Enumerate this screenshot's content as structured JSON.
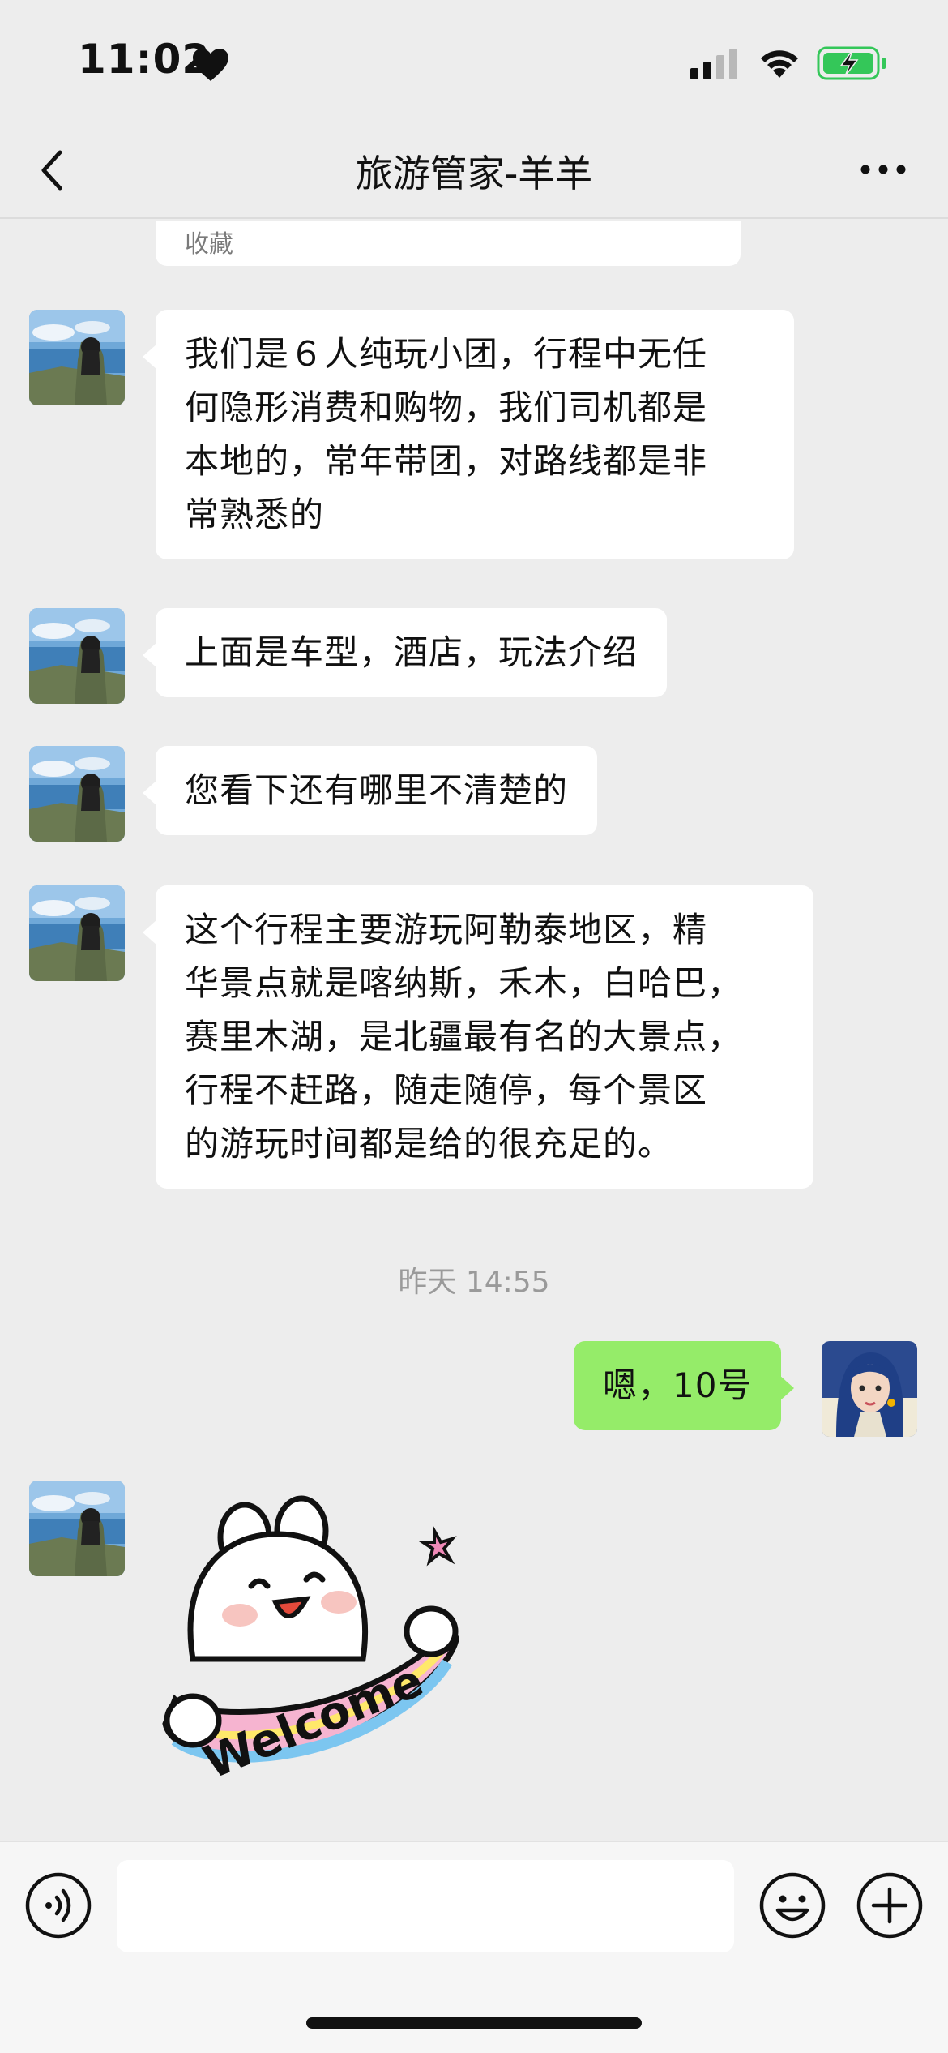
{
  "status_bar": {
    "time": "11:02"
  },
  "nav": {
    "title": "旅游管家-羊羊"
  },
  "favorite_card": {
    "label": "收藏"
  },
  "messages": [
    {
      "side": "left",
      "text_lines": [
        "我们是６人纯玩小团，行程中无任",
        "何隐形消费和购物，我们司机都是",
        "本地的，常年带团，对路线都是非",
        "常熟悉的"
      ]
    },
    {
      "side": "left",
      "text_lines": [
        "上面是车型，酒店，玩法介绍"
      ]
    },
    {
      "side": "left",
      "text_lines": [
        "您看下还有哪里不清楚的"
      ]
    },
    {
      "side": "left",
      "text_lines": [
        "这个行程主要游玩阿勒泰地区，精",
        "华景点就是喀纳斯，禾木，白哈巴，",
        "赛里木湖，是北疆最有名的大景点，",
        "行程不赶路，随走随停，每个景区",
        "的游玩时间都是给的很充足的。"
      ]
    },
    {
      "side": "right",
      "text_lines": [
        "嗯，10号"
      ]
    }
  ],
  "timestamp": "昨天 14:55",
  "sticker": {
    "text": "Welcome"
  },
  "colors": {
    "background": "#ededed",
    "self_bubble": "#95ec69",
    "other_bubble": "#ffffff",
    "battery": "#34c759"
  }
}
